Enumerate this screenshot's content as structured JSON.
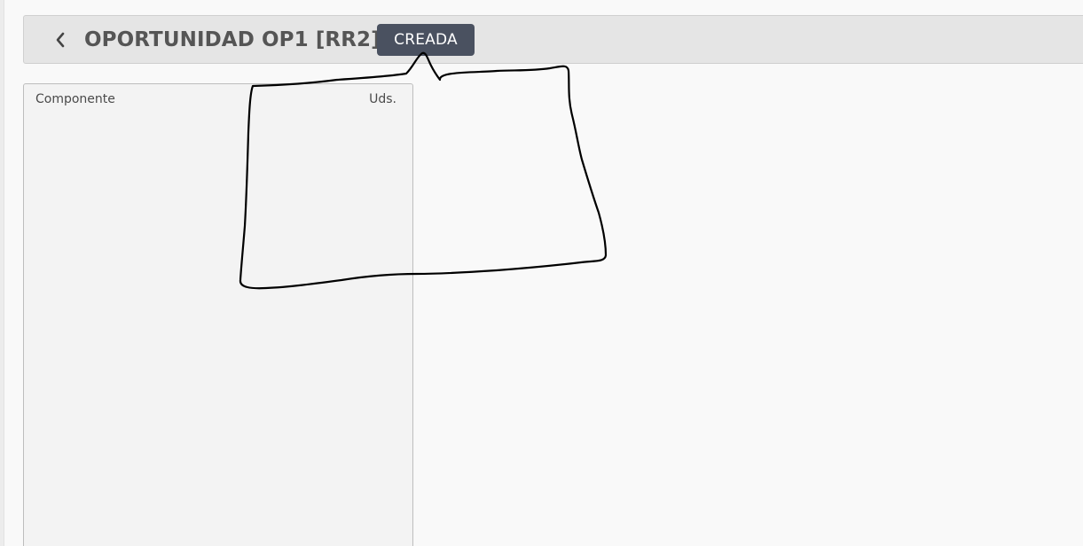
{
  "header": {
    "title": "OPORTUNIDAD OP1 [RR2]",
    "status": "CREADA",
    "back_icon": "chevron-left-icon"
  },
  "panel": {
    "columns": [
      {
        "label": "Componente"
      },
      {
        "label": "Uds."
      }
    ],
    "rows": []
  },
  "colors": {
    "header_background": "#e5e5e5",
    "status_badge": "#4a5160",
    "title_text": "#555555",
    "panel_background": "#f3f3f3",
    "page_background": "#f9f9f9",
    "annotation_stroke": "#000000"
  }
}
